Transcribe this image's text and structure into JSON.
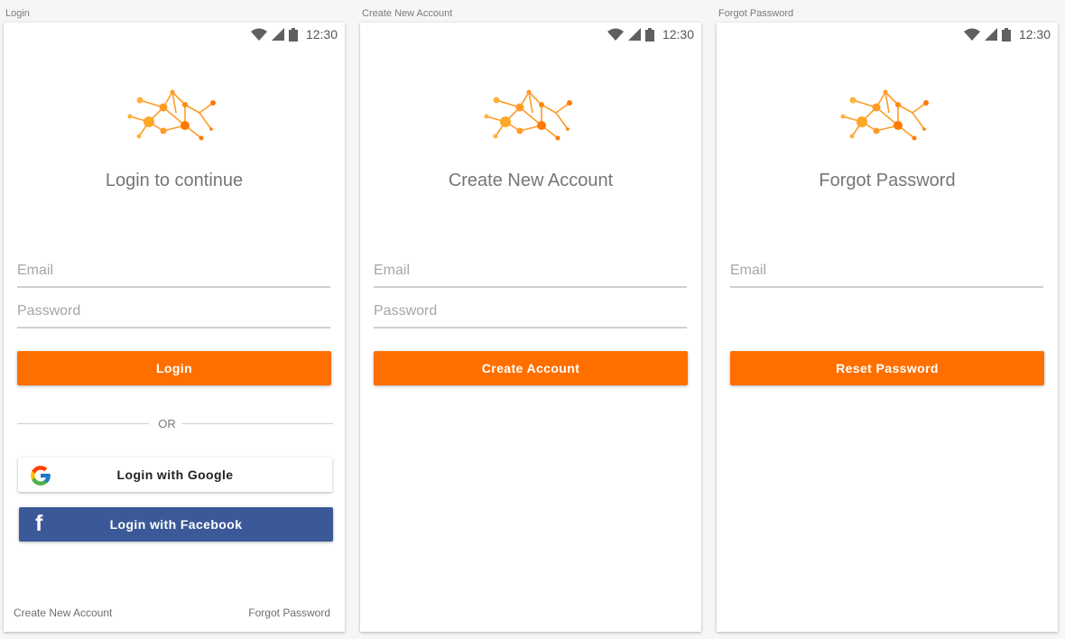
{
  "status_bar": {
    "time": "12:30"
  },
  "screens": [
    {
      "frame_label": "Login",
      "title": "Login to continue",
      "email_placeholder": "Email",
      "password_placeholder": "Password",
      "primary_button": "Login",
      "or_text": "OR",
      "google_button": "Login with Google",
      "facebook_button": "Login with Facebook",
      "create_account_link": "Create New Account",
      "forgot_password_link": "Forgot Password"
    },
    {
      "frame_label": "Create New Account",
      "title": "Create New Account",
      "email_placeholder": "Email",
      "password_placeholder": "Password",
      "primary_button": "Create Account"
    },
    {
      "frame_label": "Forgot Password",
      "title": "Forgot Password",
      "email_placeholder": "Email",
      "primary_button": "Reset Password"
    }
  ],
  "icons": {
    "status": [
      "wifi-icon",
      "cellular-signal-icon",
      "battery-icon"
    ],
    "logo": "network-nodes-logo",
    "google": "google-g-icon",
    "facebook": "facebook-f-icon"
  },
  "colors": {
    "accent": "#ff6f00",
    "logo_light": "#ffb13b",
    "logo_dark": "#ff7a00",
    "facebook_blue": "#3b5998"
  }
}
